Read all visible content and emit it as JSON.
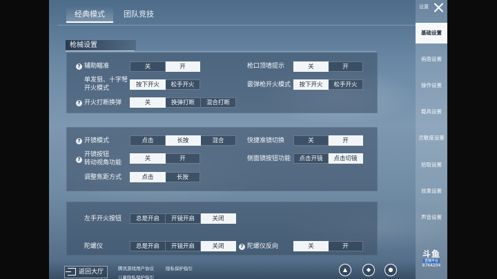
{
  "top_tabs": [
    {
      "label": "经典模式",
      "active": true
    },
    {
      "label": "团队竞技",
      "active": false
    }
  ],
  "section": {
    "title": "枪械设置"
  },
  "panel1": {
    "rows": [
      {
        "label": "辅助瞄准",
        "help": true,
        "options": [
          "关",
          "开"
        ],
        "selected": 1
      },
      {
        "label": "枪口顶墙提示",
        "help": false,
        "options": [
          "关",
          "开"
        ],
        "selected": 0
      },
      {
        "label_line1": "单发狙、十字弩",
        "label_line2": "开火模式",
        "help": false,
        "options": [
          "按下开火",
          "松手开火"
        ],
        "selected": 0
      },
      {
        "label": "霰弹枪开火模式",
        "help": false,
        "options": [
          "按下开火",
          "松手开火"
        ],
        "selected": 0
      },
      {
        "label": "开火打断换弹",
        "help": true,
        "options": [
          "关",
          "换弹打断",
          "混合打断"
        ],
        "selected": 0
      }
    ]
  },
  "panel2": {
    "rows": [
      {
        "label": "开镜模式",
        "help": true,
        "options": [
          "点击",
          "长按",
          "混合"
        ],
        "selected": 1
      },
      {
        "label": "快捷准镜切换",
        "help": false,
        "options": [
          "关",
          "开"
        ],
        "selected": 1
      },
      {
        "label_line1": "开镜按钮",
        "label_line2": "转动视角功能",
        "help": true,
        "options": [
          "关",
          "开"
        ],
        "selected": 0
      },
      {
        "label": "侧面镜按钮功能",
        "help": false,
        "options": [
          "点击开镜",
          "点击切镜"
        ],
        "selected": 1
      },
      {
        "label": "调整焦距方式",
        "help": false,
        "options": [
          "点击",
          "长按"
        ],
        "selected": 0
      }
    ]
  },
  "panel3": {
    "rows": [
      {
        "label": "左手开火按钮",
        "help": false,
        "options": [
          "总是开启",
          "开镜开启",
          "关闭"
        ],
        "selected": 2
      },
      {
        "label": "陀螺仪",
        "help": false,
        "options": [
          "总是开启",
          "开镜开启",
          "关闭"
        ],
        "selected": 2
      },
      {
        "label": "陀螺仪反向",
        "help": true,
        "options": [
          "关",
          "开"
        ],
        "selected": 0
      }
    ]
  },
  "sidebar": {
    "settings_label": "设置",
    "items": [
      "基础设置",
      "画面设置",
      "操作设置",
      "载具设置",
      "灵敏度设置",
      "拾取设置",
      "效果设置",
      "声音设置"
    ],
    "active_index": 0
  },
  "logo": {
    "mark": "斗鱼",
    "sub": "直播平台",
    "number": "8764204"
  },
  "bottom": {
    "back_label": "返回大厅",
    "links": [
      "腾讯游戏用户协议",
      "隐私保护指引",
      "儿童隐私保护指引"
    ]
  },
  "colors": {
    "selected_bg": "#f2f5f8",
    "panel_bg": "#384d64",
    "sidebar_active": "#f6f8fa"
  }
}
